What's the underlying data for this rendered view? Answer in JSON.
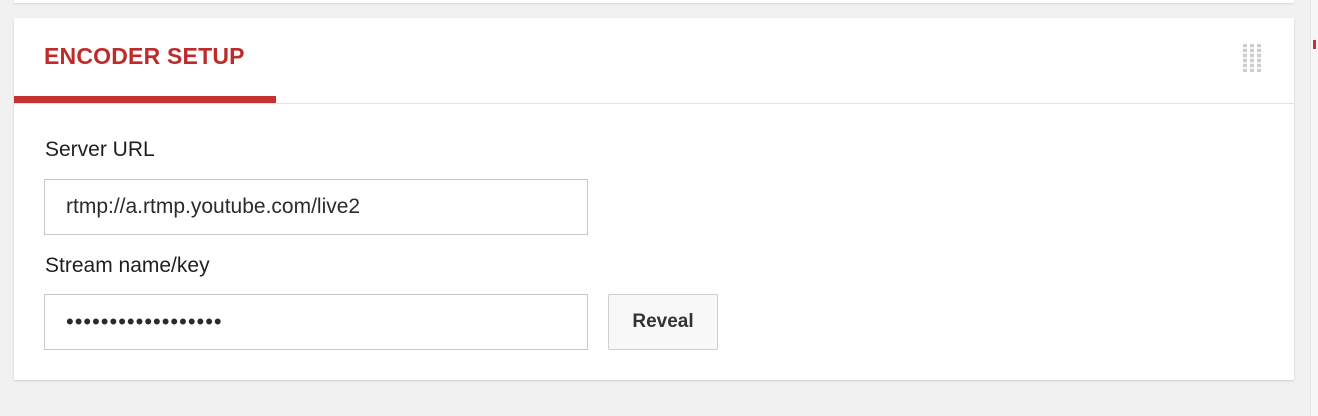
{
  "colors": {
    "accent": "#c53030",
    "background": "#f1f1f1",
    "card": "#ffffff"
  },
  "panel": {
    "tab_title": "ENCODER SETUP",
    "handle_icon": "drag-handle-icon"
  },
  "server_url": {
    "label": "Server URL",
    "value": "rtmp://a.rtmp.youtube.com/live2"
  },
  "stream_key": {
    "label": "Stream name/key",
    "value": "••••••••••••••••••",
    "reveal_label": "Reveal"
  }
}
